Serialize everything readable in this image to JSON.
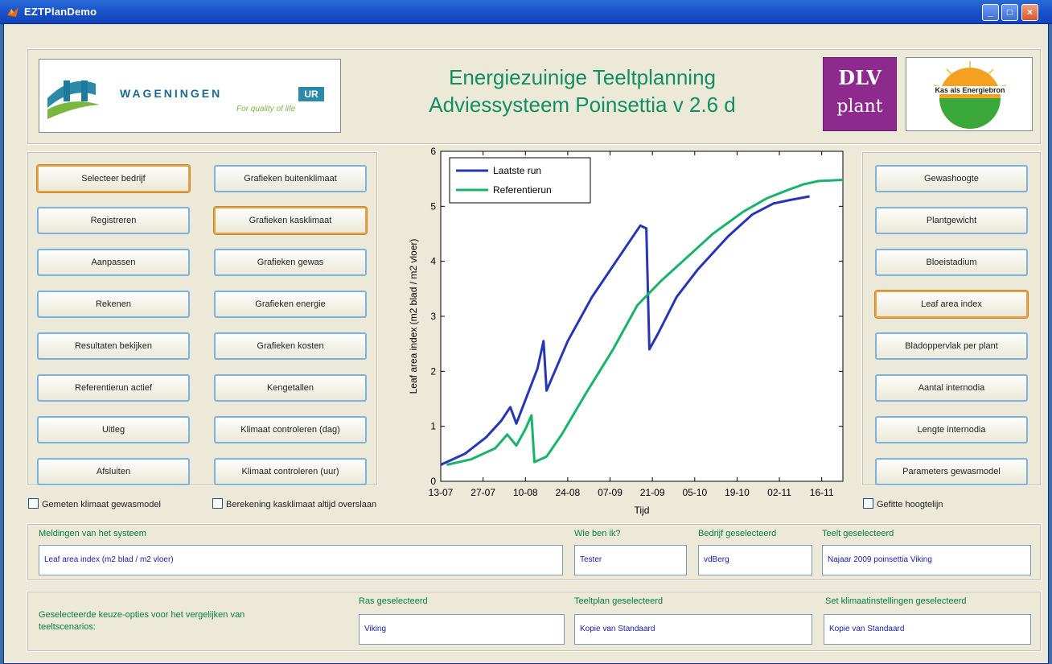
{
  "window": {
    "title": "EZTPlanDemo"
  },
  "header": {
    "title_line1": "Energiezuinige Teeltplanning",
    "title_line2": "Adviessysteem Poinsettia v 2.6 d",
    "wur_logo_text": "WAGENINGEN",
    "wur_logo_badge": "UR",
    "wur_logo_tagline": "For quality of life",
    "dlv_logo_top": "DLV",
    "dlv_logo_bottom": "plant",
    "kas_logo_text": "Kas als Energiebron"
  },
  "left_buttons": {
    "col1": [
      "Selecteer bedrijf",
      "Registreren",
      "Aanpassen",
      "Rekenen",
      "Resultaten bekijken",
      "Referentierun actief",
      "Uitleg",
      "Afsluiten"
    ],
    "col2": [
      "Grafieken buitenklimaat",
      "Grafieken kasklimaat",
      "Grafieken gewas",
      "Grafieken energie",
      "Grafieken kosten",
      "Kengetallen",
      "Klimaat controleren (dag)",
      "Klimaat controleren (uur)"
    ]
  },
  "right_buttons": [
    "Gewashoogte",
    "Plantgewicht",
    "Bloeistadium",
    "Leaf area index",
    "Bladoppervlak per plant",
    "Aantal internodia",
    "Lengte internodia",
    "Parameters gewasmodel"
  ],
  "checkboxes": {
    "gemeten": "Gemeten klimaat gewasmodel",
    "berekening": "Berekening kasklimaat altijd overslaan",
    "gefitte": "Gefitte hoogtelijn"
  },
  "messages": {
    "meldingen_label": "Meldingen van het systeem",
    "meldingen_value": "Leaf area index (m2 blad / m2 vloer)",
    "wie_label": "Wie ben ik?",
    "wie_value": "Tester",
    "bedrijf_label": "Bedrijf geselecteerd",
    "bedrijf_value": "vdBerg",
    "teelt_label": "Teelt geselecteerd",
    "teelt_value": "Najaar 2009 poinsettia Viking"
  },
  "compare": {
    "description": "Geselecteerde keuze-opties voor het vergelijken van teeltscenarios:",
    "ras_label": "Ras geselecteerd",
    "ras_value": "Viking",
    "teeltplan_label": "Teeltplan geselecteerd",
    "teeltplan_value": "Kopie van Standaard",
    "klimaat_label": "Set klimaatinstellingen geselecteerd",
    "klimaat_value": "Kopie van Standaard"
  },
  "colors": {
    "title_green": "#109060",
    "series_blue": "#2636b4",
    "series_green": "#18b46a",
    "field_text": "#1a1aa8"
  },
  "chart_data": {
    "type": "line",
    "xlabel": "Tijd",
    "ylabel": "Leaf area index (m2 blad / m2 vloer)",
    "ylim": [
      0,
      6
    ],
    "xlim": [
      0,
      133
    ],
    "x_ticks": [
      {
        "x": 0,
        "label": "13-07"
      },
      {
        "x": 14,
        "label": "27-07"
      },
      {
        "x": 28,
        "label": "10-08"
      },
      {
        "x": 42,
        "label": "24-08"
      },
      {
        "x": 56,
        "label": "07-09"
      },
      {
        "x": 70,
        "label": "21-09"
      },
      {
        "x": 84,
        "label": "05-10"
      },
      {
        "x": 98,
        "label": "19-10"
      },
      {
        "x": 112,
        "label": "02-11"
      },
      {
        "x": 126,
        "label": "16-11"
      }
    ],
    "y_ticks": [
      0,
      1,
      2,
      3,
      4,
      5,
      6
    ],
    "legend_position": "top-left",
    "series": [
      {
        "name": "Laatste run",
        "color": "#2636b4",
        "x": [
          0,
          8,
          15,
          20,
          23,
          25,
          32,
          34,
          35,
          42,
          50,
          58,
          66,
          68,
          69,
          72,
          78,
          85,
          95,
          103,
          110,
          116,
          122
        ],
        "y": [
          0.3,
          0.5,
          0.8,
          1.1,
          1.35,
          1.05,
          2.05,
          2.55,
          1.65,
          2.55,
          3.35,
          4.0,
          4.65,
          4.6,
          2.4,
          2.7,
          3.35,
          3.85,
          4.45,
          4.85,
          5.05,
          5.12,
          5.18
        ]
      },
      {
        "name": "Referentierun",
        "color": "#18b46a",
        "x": [
          2,
          10,
          18,
          22,
          25,
          28,
          30,
          31,
          35,
          40,
          48,
          57,
          65,
          73,
          82,
          90,
          100,
          108,
          115,
          120,
          125,
          133
        ],
        "y": [
          0.3,
          0.4,
          0.6,
          0.85,
          0.65,
          0.95,
          1.2,
          0.35,
          0.45,
          0.85,
          1.6,
          2.4,
          3.2,
          3.65,
          4.1,
          4.5,
          4.9,
          5.15,
          5.3,
          5.4,
          5.46,
          5.48
        ]
      }
    ]
  }
}
